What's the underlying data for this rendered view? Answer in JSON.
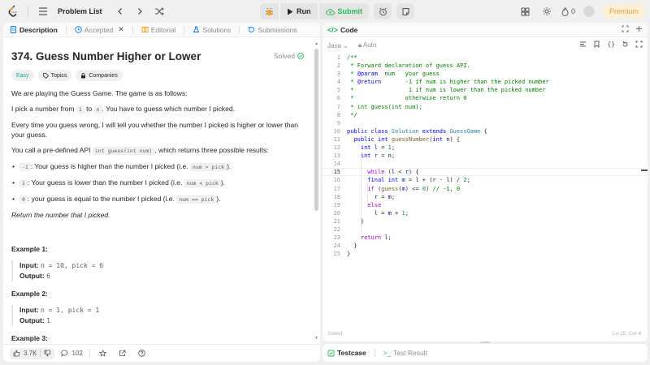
{
  "topbar": {
    "problem_list_label": "Problem List",
    "run_label": "Run",
    "submit_label": "Submit",
    "streak_count": "0",
    "premium_label": "Premium"
  },
  "left_tabs": [
    {
      "label": "Description",
      "icon": "document-icon"
    },
    {
      "label": "Accepted",
      "icon": "clock-icon"
    },
    {
      "label": "Editorial",
      "icon": "book-icon"
    },
    {
      "label": "Solutions",
      "icon": "flask-icon"
    },
    {
      "label": "Submissions",
      "icon": "history-icon"
    }
  ],
  "problem": {
    "title": "374. Guess Number Higher or Lower",
    "status": "Solved",
    "difficulty": "Easy",
    "topics_label": "Topics",
    "companies_label": "Companies",
    "p1": "We are playing the Guess Game. The game is as follows:",
    "p2_pre": "I pick a number from ",
    "p2_code1": "1",
    "p2_mid": " to ",
    "p2_code2": "n",
    "p2_post": ". You have to guess which number I picked.",
    "p3": "Every time you guess wrong, I will tell you whether the number I picked is higher or lower than your guess.",
    "p4_pre": "You call a pre-defined API ",
    "p4_code": "int guess(int num)",
    "p4_post": ", which returns three possible results:",
    "rules": [
      {
        "code": "-1",
        "text": ": Your guess is higher than the number I picked (i.e. ",
        "code2": "num > pick",
        "end": ")."
      },
      {
        "code": "1",
        "text": ": Your guess is lower than the number I picked (i.e. ",
        "code2": "num < pick",
        "end": ")."
      },
      {
        "code": "0",
        "text": ": your guess is equal to the number I picked (i.e. ",
        "code2": "num == pick",
        "end": ")."
      }
    ],
    "ret_pre": "Return ",
    "ret_em": "the number that I picked",
    "ret_post": ".",
    "examples": [
      {
        "title": "Example 1:",
        "input_label": "Input:",
        "input": "n = 10, pick = 6",
        "output_label": "Output:",
        "output": "6"
      },
      {
        "title": "Example 2:",
        "input_label": "Input:",
        "input": "n = 1, pick = 1",
        "output_label": "Output:",
        "output": "1"
      },
      {
        "title": "Example 3:"
      }
    ]
  },
  "bottom_bar": {
    "likes": "3.7K",
    "comments": "102"
  },
  "code_panel": {
    "title": "Code",
    "language": "Java",
    "mode": "Auto",
    "saved_label": "Saved",
    "cursor_pos": "Ln 15, Col 4"
  },
  "code_lines": [
    "1",
    "2",
    "3",
    "4",
    "5",
    "6",
    "7",
    "8",
    "9",
    "10",
    "11",
    "12",
    "13",
    "14",
    "15",
    "16",
    "17",
    "18",
    "19",
    "20",
    "21",
    "22",
    "23",
    "24",
    "25"
  ],
  "testcase": {
    "tab1": "Testcase",
    "tab2": "Test Result"
  }
}
